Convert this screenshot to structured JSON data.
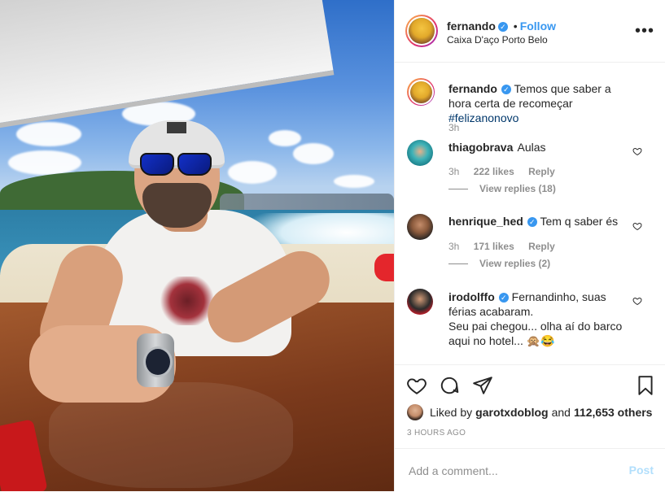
{
  "post": {
    "author": "fernando",
    "follow_label": "Follow",
    "dot": "•",
    "location": "Caixa D'aço Porto Belo",
    "more_icon": "more-horizontal-icon",
    "caption": {
      "username": "fernando",
      "text": "Temos que saber a hora certa de recomeçar ",
      "hashtag": "#felizanonovo",
      "time": "3h"
    }
  },
  "comments": [
    {
      "username": "thiagobrava",
      "verified": false,
      "text": "Aulas",
      "time": "3h",
      "likes": "222 likes",
      "reply": "Reply",
      "view_replies": "View replies (18)"
    },
    {
      "username": "henrique_hed",
      "verified": true,
      "text": "Tem q saber és",
      "time": "3h",
      "likes": "171 likes",
      "reply": "Reply",
      "view_replies": "View replies (2)"
    },
    {
      "username": "irodolffo",
      "verified": true,
      "text": "Fernandinho, suas férias acabaram.",
      "text2": "Seu pai chegou... olha aí do barco aqui no hotel... 🙊😂"
    }
  ],
  "actions": {
    "like_icon": "heart-icon",
    "comment_icon": "comment-icon",
    "share_icon": "send-icon",
    "save_icon": "bookmark-icon"
  },
  "liked_by": {
    "prefix": "Liked by",
    "user": "garotxdoblog",
    "conj": "and",
    "count": "112,653 others"
  },
  "time_ago": "3 HOURS AGO",
  "add_comment": {
    "placeholder": "Add a comment...",
    "post_label": "Post"
  },
  "colors": {
    "link_blue": "#3897f0",
    "post_disabled": "#b2dffc",
    "muted": "#8e8e8e"
  }
}
